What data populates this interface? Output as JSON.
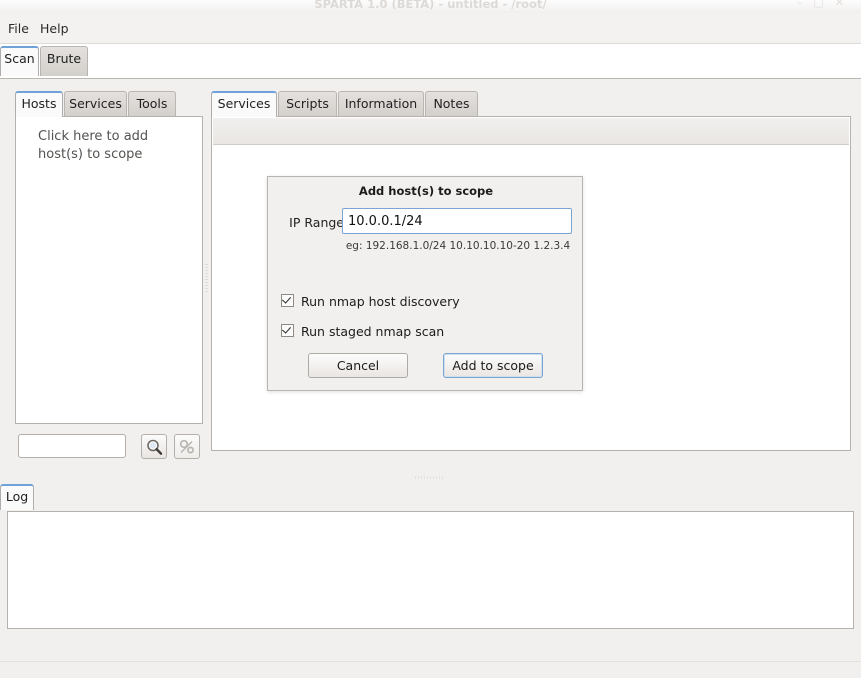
{
  "window": {
    "title": "SPARTA 1.0 (BETA) - untitled - /root/",
    "minimize_icon": "minimize-icon",
    "maximize_icon": "maximize-icon",
    "close_icon": "close-icon"
  },
  "menubar": {
    "items": [
      {
        "label": "File"
      },
      {
        "label": "Help"
      }
    ]
  },
  "outer_tabs": [
    {
      "label": "Scan",
      "selected": true
    },
    {
      "label": "Brute",
      "selected": false
    }
  ],
  "left_panel": {
    "tabs": [
      {
        "label": "Hosts",
        "selected": true
      },
      {
        "label": "Services",
        "selected": false
      },
      {
        "label": "Tools",
        "selected": false
      }
    ],
    "hint_line1": "Click here to add",
    "hint_line2": "host(s) to scope",
    "search": {
      "value": "",
      "placeholder": ""
    },
    "search_button_icon": "search-icon",
    "tools_button_icon": "tools-icon"
  },
  "right_panel": {
    "tabs": [
      {
        "label": "Services",
        "selected": true
      },
      {
        "label": "Scripts",
        "selected": false
      },
      {
        "label": "Information",
        "selected": false
      },
      {
        "label": "Notes",
        "selected": false
      }
    ]
  },
  "log_panel": {
    "tabs": [
      {
        "label": "Log",
        "selected": true
      }
    ],
    "content": ""
  },
  "statusbar": {
    "text": ""
  },
  "dialog": {
    "title": "Add host(s) to scope",
    "ip_range_label": "IP Range",
    "ip_range_value": "10.0.0.1/24",
    "ip_range_placeholder": "",
    "hint": "eg: 192.168.1.0/24 10.10.10.10-20 1.2.3.4",
    "checkboxes": [
      {
        "label": "Run nmap host discovery",
        "checked": true
      },
      {
        "label": "Run staged nmap scan",
        "checked": true
      }
    ],
    "cancel_label": "Cancel",
    "submit_label": "Add to scope"
  },
  "colors": {
    "accent": "#6ea2d8",
    "focus_border": "#7aa5d2",
    "panel_bg": "#f2f0ee",
    "content_bg": "#ffffff"
  }
}
